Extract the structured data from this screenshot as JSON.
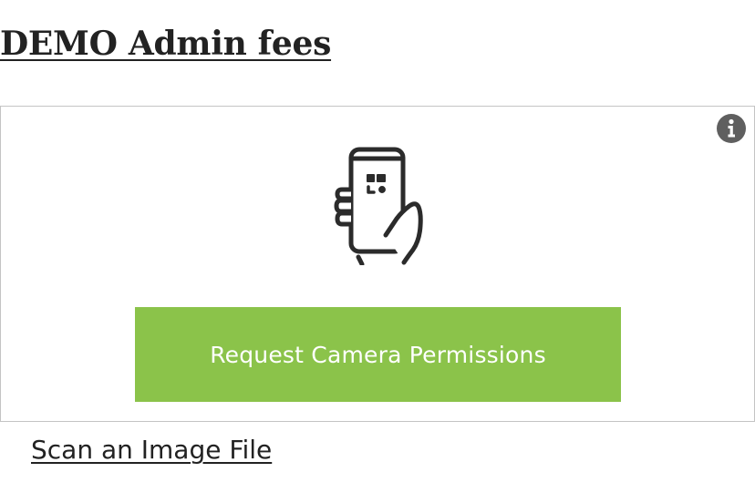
{
  "page": {
    "title": "DEMO Admin fees"
  },
  "scanner": {
    "info_icon": "info-circle-icon",
    "illustration_icon": "hand-holding-phone-qr-icon",
    "request_button_label": "Request Camera Permissions",
    "request_button_color": "#8bc34a"
  },
  "footer": {
    "scan_file_link": "Scan an Image File"
  }
}
